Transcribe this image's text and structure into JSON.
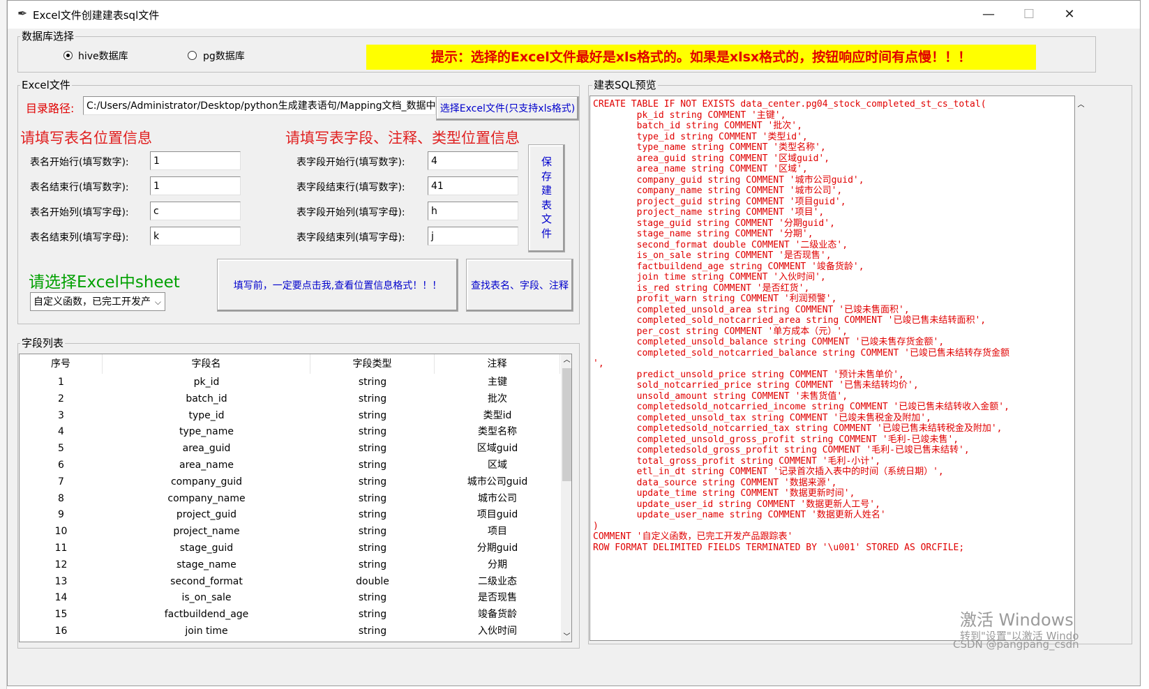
{
  "window": {
    "title": "Excel文件创建建表sql文件",
    "minimize": "—",
    "maximize": "☐",
    "close": "✕"
  },
  "db_group": {
    "label": "数据库选择",
    "hive_label": "hive数据库",
    "pg_label": "pg数据库",
    "selected": "hive"
  },
  "hint": "提示：选择的Excel文件最好是xls格式的。如果是xlsx格式的，按钮响应时间有点慢！！！",
  "excel_group": {
    "label": "Excel文件",
    "path_label": "目录路径:",
    "path_value": "C:/Users/Administrator/Desktop/python生成建表语句/Mapping文档_数据中",
    "choose_button": "选择Excel文件(只支持xls格式)",
    "table_pos_heading": "请填写表名位置信息",
    "field_pos_heading": "请填写表字段、注释、类型位置信息",
    "table_fields": [
      {
        "label": "表名开始行(填写数字):",
        "value": "1"
      },
      {
        "label": "表名结束行(填写数字):",
        "value": "1"
      },
      {
        "label": "表名开始列(填写字母):",
        "value": "c"
      },
      {
        "label": "表名结束列(填写字母):",
        "value": "k"
      }
    ],
    "field_fields": [
      {
        "label": "表字段开始行(填写数字):",
        "value": "4"
      },
      {
        "label": "表字段结束行(填写数字):",
        "value": "41"
      },
      {
        "label": "表字段开始列(填写字母):",
        "value": "h"
      },
      {
        "label": "表字段结束列(填写字母):",
        "value": "j"
      }
    ],
    "save_button_chars": [
      "保",
      "存",
      "建",
      "表",
      "文",
      "件"
    ],
    "sheet_heading": "请选择Excel中sheet",
    "sheet_selected": "自定义函数，已完工开发产",
    "help_button": "填写前，一定要点击我,查看位置信息格式！！！",
    "find_button": "查找表名、字段、注释"
  },
  "field_list": {
    "label": "字段列表",
    "columns": [
      "序号",
      "字段名",
      "字段类型",
      "注释"
    ],
    "rows": [
      [
        "1",
        "pk_id",
        "string",
        "主键"
      ],
      [
        "2",
        "batch_id",
        "string",
        "批次"
      ],
      [
        "3",
        "type_id",
        "string",
        "类型id"
      ],
      [
        "4",
        "type_name",
        "string",
        "类型名称"
      ],
      [
        "5",
        "area_guid",
        "string",
        "区域guid"
      ],
      [
        "6",
        "area_name",
        "string",
        "区域"
      ],
      [
        "7",
        "company_guid",
        "string",
        "城市公司guid"
      ],
      [
        "8",
        "company_name",
        "string",
        "城市公司"
      ],
      [
        "9",
        "project_guid",
        "string",
        "项目guid"
      ],
      [
        "10",
        "project_name",
        "string",
        "项目"
      ],
      [
        "11",
        "stage_guid",
        "string",
        "分期guid"
      ],
      [
        "12",
        "stage_name",
        "string",
        "分期"
      ],
      [
        "13",
        "second_format",
        "double",
        "二级业态"
      ],
      [
        "14",
        "is_on_sale",
        "string",
        "是否现售"
      ],
      [
        "15",
        "factbuildend_age",
        "string",
        "竣备货龄"
      ],
      [
        "16",
        "join time",
        "string",
        "入伙时间"
      ]
    ]
  },
  "sql_preview": {
    "label": "建表SQL预览",
    "text": "CREATE TABLE IF NOT EXISTS data_center.pg04_stock_completed_st_cs_total(\n        pk_id string COMMENT '主键',\n        batch_id string COMMENT '批次',\n        type_id string COMMENT '类型id',\n        type_name string COMMENT '类型名称',\n        area_guid string COMMENT '区域guid',\n        area_name string COMMENT '区域',\n        company_guid string COMMENT '城市公司guid',\n        company_name string COMMENT '城市公司',\n        project_guid string COMMENT '项目guid',\n        project_name string COMMENT '项目',\n        stage_guid string COMMENT '分期guid',\n        stage_name string COMMENT '分期',\n        second_format double COMMENT '二级业态',\n        is_on_sale string COMMENT '是否现售',\n        factbuildend_age string COMMENT '竣备货龄',\n        join time string COMMENT '入伙时间',\n        is_red string COMMENT '是否红货',\n        profit_warn string COMMENT '利润预警',\n        completed_unsold_area string COMMENT '已竣未售面积',\n        completed_sold_notcarried_area string COMMENT '已竣已售未结转面积',\n        per_cost string COMMENT '单方成本（元）',\n        completed_unsold_balance string COMMENT '已竣未售存货金额',\n        completed_sold_notcarried_balance string COMMENT '已竣已售未结转存货金额\n',\n        predict_unsold_price string COMMENT '预计未售单价',\n        sold_notcarried_price string COMMENT '已售未结转均价',\n        unsold_amount string COMMENT '未售货值',\n        completedsold_notcarried_income string COMMENT '已竣已售未结转收入金额',\n        completed_unsold_tax string COMMENT '已竣未售税金及附加',\n        completedsold_notcarried_tax string COMMENT '已竣已售未结转税金及附加',\n        completed_unsold_gross_profit string COMMENT '毛利-已竣未售',\n        completedsold_gross_profit string COMMENT '毛利-已竣已售未结转',\n        total_gross_profit string COMMENT '毛利-小计',\n        etl_in_dt string COMMENT '记录首次插入表中的时间（系统日期）',\n        data_source string COMMENT '数据来源',\n        update_time string COMMENT '数据更新时间',\n        update_user_id string COMMENT '数据更新人工号',\n        update_user_name string COMMENT '数据更新人姓名'\n)\nCOMMENT '自定义函数，已完工开发产品跟踪表'\nROW FORMAT DELIMITED FIELDS TERMINATED BY '\\u001' STORED AS ORCFILE;"
  },
  "watermark": {
    "line1": "激活 Windows",
    "line2": "转到\"设置\"以激活 Windo",
    "csdn": "CSDN @pangpang_csdn"
  }
}
